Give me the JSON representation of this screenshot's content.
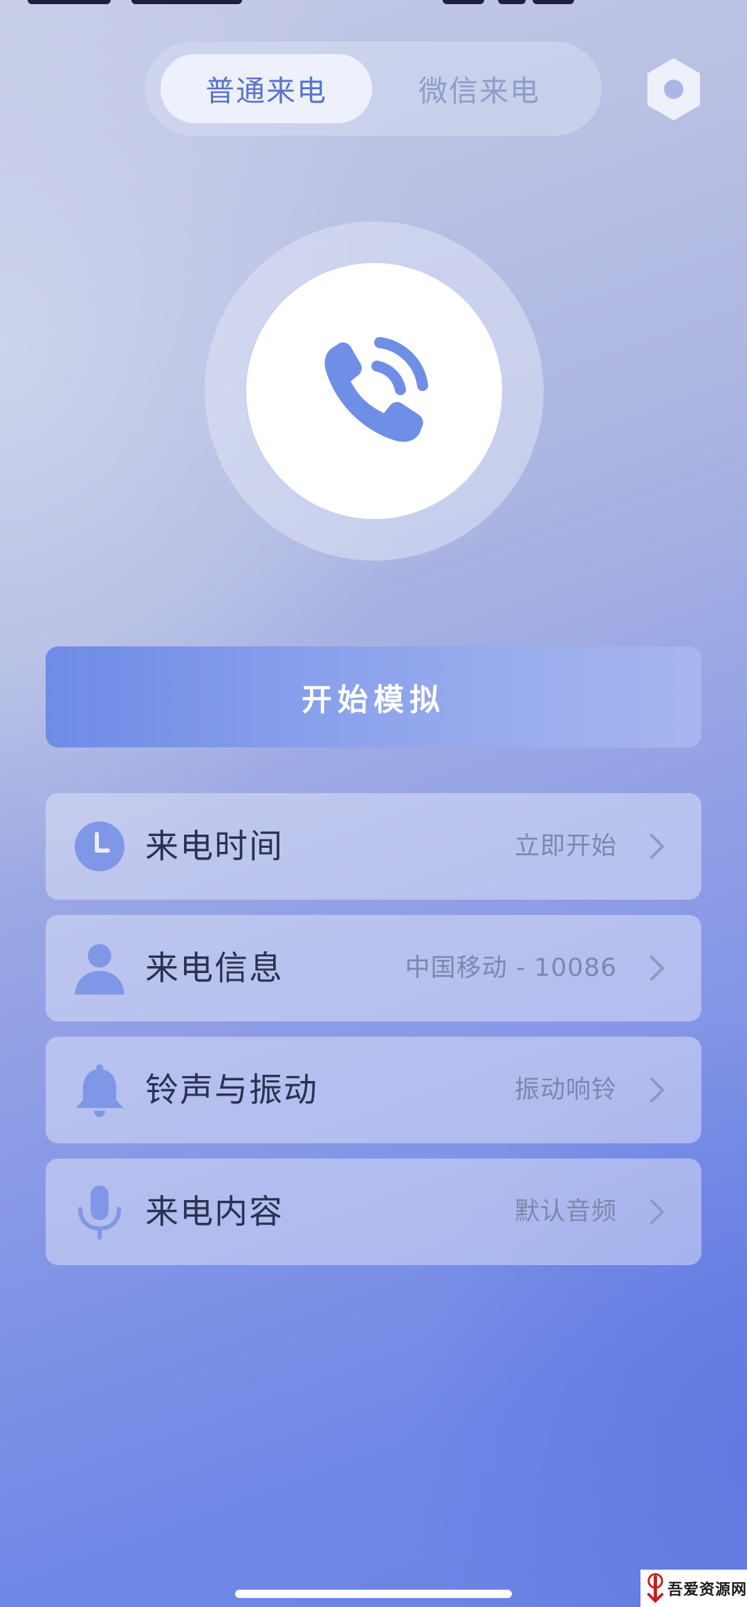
{
  "tabs": [
    {
      "label": "普通来电",
      "active": true
    },
    {
      "label": "微信来电",
      "active": false
    }
  ],
  "icons": {
    "settings": "settings-hexagon-icon",
    "call": "phone-ringing-icon"
  },
  "start_button": {
    "label": "开始模拟"
  },
  "rows": [
    {
      "icon": "clock-icon",
      "label": "来电时间",
      "value": "立即开始"
    },
    {
      "icon": "person-icon",
      "label": "来电信息",
      "value": "中国移动 - 10086"
    },
    {
      "icon": "bell-icon",
      "label": "铃声与振动",
      "value": "振动响铃"
    },
    {
      "icon": "microphone-icon",
      "label": "来电内容",
      "value": "默认音频"
    }
  ],
  "watermark": {
    "text": "吾爱资源网"
  },
  "colors": {
    "accent": "#6e8be7",
    "icon_blue": "#7f97e6",
    "active_tab_text": "#5a74c9",
    "inactive_tab_text": "#8f9cc8",
    "row_label": "#2b3150",
    "row_value": "#7d87ad"
  }
}
